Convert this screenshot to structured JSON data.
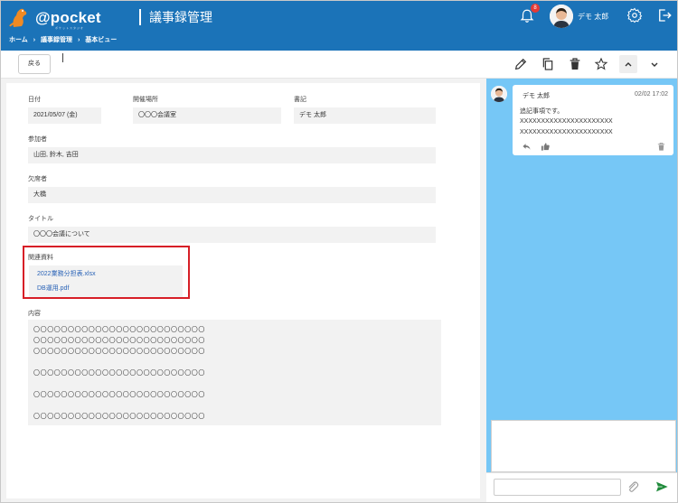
{
  "app": {
    "logo_text": "@pocket",
    "logo_sub": "ポケットスタジオ",
    "title": "議事録管理"
  },
  "header": {
    "notification_count": "8",
    "user_name": "デモ 太郎"
  },
  "breadcrumb": [
    "ホーム",
    "›",
    "議事録管理",
    "›",
    "基本ビュー"
  ],
  "toolbar": {
    "back_label": "戻る"
  },
  "form": {
    "date_label": "日付",
    "date_value": "2021/05/07 (金)",
    "place_label": "開催場所",
    "place_value": "〇〇〇会議室",
    "writer_label": "書記",
    "writer_value": "デモ 太郎",
    "attendees_label": "参加者",
    "attendees_value": "山田, 鈴木, 吉田",
    "absentees_label": "欠席者",
    "absentees_value": "大橋",
    "title_label": "タイトル",
    "title_value": "〇〇〇会議について",
    "docs_label": "関連資料",
    "docs": [
      "2022業務分担表.xlsx",
      "DB運用.pdf"
    ],
    "content_label": "内容",
    "content_lines": [
      "〇〇〇〇〇〇〇〇〇〇〇〇〇〇〇〇〇〇〇〇〇〇〇〇〇",
      "〇〇〇〇〇〇〇〇〇〇〇〇〇〇〇〇〇〇〇〇〇〇〇〇〇",
      "〇〇〇〇〇〇〇〇〇〇〇〇〇〇〇〇〇〇〇〇〇〇〇〇〇",
      "〇〇〇〇〇〇〇〇〇〇〇〇〇〇〇〇〇〇〇〇〇〇〇〇〇",
      "〇〇〇〇〇〇〇〇〇〇〇〇〇〇〇〇〇〇〇〇〇〇〇〇〇",
      "〇〇〇〇〇〇〇〇〇〇〇〇〇〇〇〇〇〇〇〇〇〇〇〇〇"
    ]
  },
  "comment": {
    "author": "デモ 太郎",
    "time": "02/02 17:02",
    "lines": [
      "追記事項です。",
      "XXXXXXXXXXXXXXXXXXXXXX",
      "XXXXXXXXXXXXXXXXXXXXXX"
    ]
  },
  "colors": {
    "header": "#1b73b8",
    "side_panel": "#76c7f6",
    "highlight": "#d71f27",
    "link": "#2a63b7"
  }
}
